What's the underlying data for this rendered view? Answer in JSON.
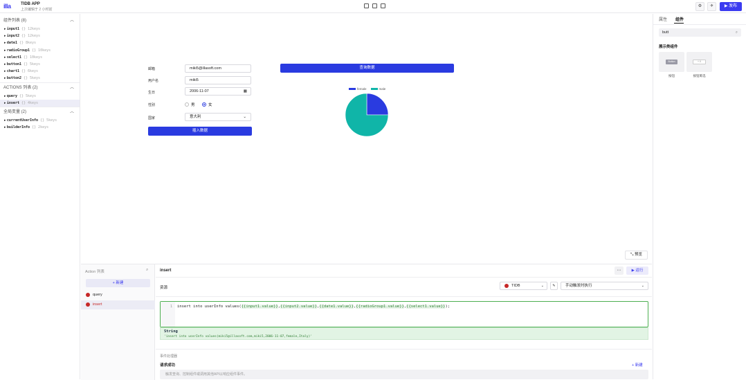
{
  "app": {
    "logo": "illa",
    "title": "TIDB APP",
    "subtitle": "上次编辑于 2 小时前",
    "publish_label": "▶ 发布"
  },
  "left_panel": {
    "components": {
      "title": "组件列表 (8)",
      "items": [
        {
          "name": "input1",
          "keys": "{} 12keys"
        },
        {
          "name": "input2",
          "keys": "{} 12keys"
        },
        {
          "name": "date1",
          "keys": "{} 8keys"
        },
        {
          "name": "radioGroup1",
          "keys": "{} 10keys"
        },
        {
          "name": "select1",
          "keys": "{} 10keys"
        },
        {
          "name": "button1",
          "keys": "{} 5keys"
        },
        {
          "name": "chart1",
          "keys": "{} 6keys"
        },
        {
          "name": "button2",
          "keys": "{} 5keys"
        }
      ]
    },
    "actions": {
      "title": "ACTIONS 列表 (2)",
      "items": [
        {
          "name": "query",
          "keys": "{} 5keys"
        },
        {
          "name": "insert",
          "keys": "{} 4keys"
        }
      ]
    },
    "globals": {
      "title": "全局变量 (2)",
      "items": [
        {
          "name": "currentUserInfo",
          "keys": "{} 5keys"
        },
        {
          "name": "builderInfo",
          "keys": "{} 2keys"
        }
      ]
    }
  },
  "canvas": {
    "form": {
      "email_label": "邮箱",
      "email_value": "miki5@illasoft.com",
      "username_label": "用户名",
      "username_value": "miki5",
      "birthday_label": "生日",
      "birthday_value": "2006-11-07",
      "gender_label": "性别",
      "gender_options": [
        "男",
        "女"
      ],
      "gender_selected": "女",
      "country_label": "国家",
      "country_value": "意大利",
      "submit_label": "插入数据"
    },
    "query_button_label": "查询数据",
    "preview_label": "⤡ 预览",
    "chart_colors": {
      "female": "#2a3be0",
      "male": "#10b5a8"
    }
  },
  "chart_data": {
    "type": "pie",
    "labels": [
      "female",
      "male"
    ],
    "values": [
      25,
      75
    ],
    "legend": "top"
  },
  "right_panel": {
    "tabs": [
      "属性",
      "组件"
    ],
    "active_tab": "组件",
    "search_value": "butt",
    "category": "展示类组件",
    "components": [
      {
        "label": "按钮",
        "chip": "Button"
      },
      {
        "label": "按钮筹选",
        "chip": "+ 0"
      }
    ]
  },
  "action_panel": {
    "list_title": "Action 列表",
    "new_label": "+ 新建",
    "actions": [
      {
        "name": "query",
        "selected": false
      },
      {
        "name": "insert",
        "selected": true
      }
    ],
    "editor": {
      "title": "insert",
      "run_label": "▶ 运行",
      "resource_label": "资源",
      "resource_value": "TIDB",
      "trigger_value": "手动触发时执行",
      "line_number": "1",
      "code_prefix": "insert into userInfo values(",
      "code_parts": [
        "{{input1.value}}",
        "{{input2.value}}",
        "{{date1.value}}",
        "{{radioGroup1.value}}",
        "{{select1.value}}"
      ],
      "code_suffix": ");",
      "tip_type": "String",
      "tip_value": "'insert into userInfo values(miki5@illasoft.com,miki5,2006-11-07,female,Italy)'",
      "events_label": "事件处理器",
      "success_label": "请求成功",
      "new_event_label": "+ 新建",
      "event_hint": "触发查询、控制组件或调用其他API以响应组件事件。"
    }
  }
}
